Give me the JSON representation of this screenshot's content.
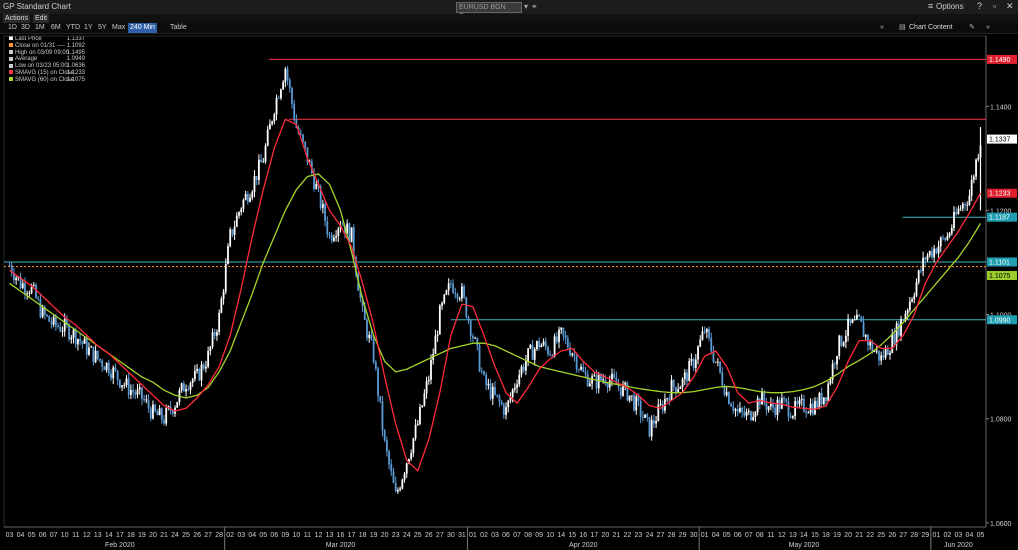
{
  "window": {
    "title": "GP Standard Chart",
    "ticker": "EURUSD BGN Curncy",
    "options_label": "Options"
  },
  "menu": {
    "actions": "Actions",
    "edit": "Edit"
  },
  "ranges": [
    "1D",
    "3D",
    "1M",
    "6M",
    "YTD",
    "1Y",
    "5Y",
    "Max",
    "240 Min"
  ],
  "selected_range": "240 Min",
  "table_label": "Table",
  "chart_content_label": "Chart Content",
  "legend": [
    {
      "label": "Last Price",
      "value": "1.1337",
      "color": "#ffffff"
    },
    {
      "label": "Close on 01/31 ----",
      "value": "1.1092",
      "color": "#ff9933"
    },
    {
      "label": "High on 03/09 09:00",
      "value": "1.1495",
      "color": "#cccccc"
    },
    {
      "label": "Average",
      "value": "1.0949",
      "color": "#cccccc"
    },
    {
      "label": "Low on 03/23 05:00",
      "value": "1.0636",
      "color": "#cccccc"
    },
    {
      "label": "SMAVG (15) on Close",
      "value": "1.1233",
      "color": "#ff3344"
    },
    {
      "label": "SMAVG (60) on Close",
      "value": "1.1075",
      "color": "#aadd33"
    }
  ],
  "colors": {
    "price": "#ffffff",
    "price_down": "#5b9bd5",
    "sma15": "#ff2a3a",
    "sma60": "#a6d52a",
    "red_hline": "#ff3344",
    "cyan_hline": "#3fb8c8",
    "close_hline": "#ff9933"
  },
  "chart_data": {
    "type": "line",
    "ylim": [
      1.0592,
      1.1535
    ],
    "y_ticks": [
      1.06,
      1.08,
      1.1,
      1.12,
      1.14
    ],
    "y_tick_labels": [
      "1.0600",
      "1.0800",
      "1.1000",
      "1.1200",
      "1.1400"
    ],
    "right_labels": [
      {
        "value": 1.149,
        "text": "1.1490",
        "style": "red"
      },
      {
        "value": 1.1337,
        "text": "1.1337",
        "style": "white"
      },
      {
        "value": 1.1233,
        "text": "1.1233",
        "style": "red"
      },
      {
        "value": 1.1187,
        "text": "1.1187",
        "style": "cyan"
      },
      {
        "value": 1.1101,
        "text": "1.1101",
        "style": "cyan"
      },
      {
        "value": 1.1075,
        "text": "1.1075",
        "style": "green"
      },
      {
        "value": 1.099,
        "text": "1.0990",
        "style": "cyan"
      }
    ],
    "hlines": [
      {
        "value": 1.149,
        "style": "red",
        "from": 0.27
      },
      {
        "value": 1.1375,
        "style": "red",
        "from": 0.29
      },
      {
        "value": 1.1187,
        "style": "cyan",
        "from": 0.915
      },
      {
        "value": 1.1101,
        "style": "cyan",
        "from": 0.0
      },
      {
        "value": 1.1092,
        "style": "close",
        "from": 0.0
      },
      {
        "value": 1.099,
        "style": "cyan",
        "from": 0.455
      }
    ],
    "x_days": [
      "03",
      "04",
      "05",
      "06",
      "07",
      "10",
      "11",
      "12",
      "13",
      "14",
      "17",
      "18",
      "19",
      "20",
      "21",
      "24",
      "25",
      "26",
      "27",
      "28",
      "02",
      "03",
      "04",
      "05",
      "06",
      "09",
      "10",
      "11",
      "12",
      "13",
      "16",
      "17",
      "18",
      "19",
      "20",
      "23",
      "24",
      "25",
      "26",
      "27",
      "30",
      "31",
      "01",
      "02",
      "03",
      "06",
      "07",
      "08",
      "09",
      "10",
      "14",
      "15",
      "16",
      "17",
      "20",
      "21",
      "22",
      "23",
      "24",
      "27",
      "28",
      "29",
      "30",
      "01",
      "04",
      "05",
      "06",
      "07",
      "08",
      "11",
      "12",
      "13",
      "14",
      "15",
      "18",
      "19",
      "20",
      "21",
      "22",
      "25",
      "26",
      "27",
      "28",
      "29",
      "01",
      "02",
      "03",
      "04",
      "05"
    ],
    "months": [
      {
        "label": "Feb 2020",
        "day_index": 10
      },
      {
        "label": "Mar 2020",
        "day_index": 30
      },
      {
        "label": "Apr 2020",
        "day_index": 52
      },
      {
        "label": "May 2020",
        "day_index": 72
      },
      {
        "label": "Jun 2020",
        "day_index": 86
      }
    ],
    "month_starts": [
      20,
      42,
      63,
      84
    ],
    "series": [
      {
        "name": "Last Price",
        "style": "price",
        "values": [
          1.1095,
          1.106,
          1.105,
          1.1,
          1.098,
          1.0975,
          1.096,
          1.0935,
          1.0915,
          1.09,
          1.0875,
          1.0855,
          1.084,
          1.081,
          1.08,
          1.083,
          1.087,
          1.088,
          1.092,
          1.0995,
          1.115,
          1.121,
          1.125,
          1.13,
          1.14,
          1.1475,
          1.136,
          1.13,
          1.123,
          1.115,
          1.118,
          1.115,
          1.1,
          1.092,
          1.075,
          1.065,
          1.072,
          1.079,
          1.088,
          1.1,
          1.106,
          1.104,
          1.096,
          1.087,
          1.084,
          1.0815,
          1.088,
          1.092,
          1.0945,
          1.093,
          1.096,
          1.093,
          1.0885,
          1.087,
          1.088,
          1.0865,
          1.085,
          1.082,
          1.078,
          1.082,
          1.086,
          1.087,
          1.091,
          1.097,
          1.091,
          1.085,
          1.081,
          1.0805,
          1.084,
          1.082,
          1.083,
          1.0815,
          1.0825,
          1.0825,
          1.085,
          1.0935,
          1.0975,
          1.0985,
          1.094,
          1.0915,
          1.095,
          1.0995,
          1.105,
          1.111,
          1.113,
          1.115,
          1.12,
          1.123,
          1.1337
        ]
      },
      {
        "name": "SMAVG (15) on Close",
        "style": "sma15",
        "values": [
          1.1085,
          1.107,
          1.1055,
          1.1035,
          1.1015,
          1.0995,
          1.098,
          1.096,
          1.094,
          1.0925,
          1.0905,
          1.0885,
          1.0865,
          1.0845,
          1.0825,
          1.0815,
          1.082,
          1.084,
          1.0865,
          1.09,
          1.096,
          1.105,
          1.115,
          1.124,
          1.132,
          1.1375,
          1.1365,
          1.13,
          1.125,
          1.12,
          1.117,
          1.113,
          1.106,
          1.098,
          1.088,
          1.079,
          1.072,
          1.07,
          1.076,
          1.085,
          1.096,
          1.102,
          1.1015,
          1.096,
          1.09,
          1.085,
          1.083,
          1.086,
          1.0895,
          1.0915,
          1.093,
          1.0935,
          1.091,
          1.089,
          1.088,
          1.087,
          1.086,
          1.0845,
          1.0825,
          1.082,
          1.0835,
          1.085,
          1.088,
          1.092,
          1.093,
          1.09,
          1.085,
          1.083,
          1.0835,
          1.083,
          1.0828,
          1.0822,
          1.082,
          1.0818,
          1.0825,
          1.086,
          1.091,
          1.095,
          1.095,
          1.0935,
          1.0935,
          1.096,
          1.1,
          1.106,
          1.11,
          1.113,
          1.116,
          1.1195,
          1.1233
        ]
      },
      {
        "name": "SMAVG (60) on Close",
        "style": "sma60",
        "values": [
          1.106,
          1.1045,
          1.103,
          1.1015,
          1.1,
          1.0985,
          1.097,
          1.0955,
          1.094,
          1.0925,
          1.091,
          1.0895,
          1.088,
          1.087,
          1.0855,
          1.0845,
          1.084,
          1.0845,
          1.086,
          1.089,
          1.093,
          1.0985,
          1.104,
          1.11,
          1.115,
          1.12,
          1.124,
          1.1265,
          1.127,
          1.125,
          1.12,
          1.112,
          1.103,
          1.096,
          1.091,
          1.089,
          1.0895,
          1.0905,
          1.0915,
          1.0925,
          1.0935,
          1.094,
          1.0945,
          1.0945,
          1.094,
          1.093,
          1.092,
          1.091,
          1.09,
          1.0895,
          1.089,
          1.0885,
          1.088,
          1.0875,
          1.087,
          1.0866,
          1.0862,
          1.0858,
          1.0855,
          1.0852,
          1.085,
          1.085,
          1.0852,
          1.0856,
          1.086,
          1.0862,
          1.086,
          1.0856,
          1.0852,
          1.085,
          1.085,
          1.0852,
          1.0856,
          1.0862,
          1.0872,
          1.0885,
          1.09,
          1.0912,
          1.0925,
          1.0942,
          1.0962,
          1.0985,
          1.101,
          1.1035,
          1.106,
          1.1085,
          1.111,
          1.114,
          1.1175
        ]
      }
    ]
  }
}
